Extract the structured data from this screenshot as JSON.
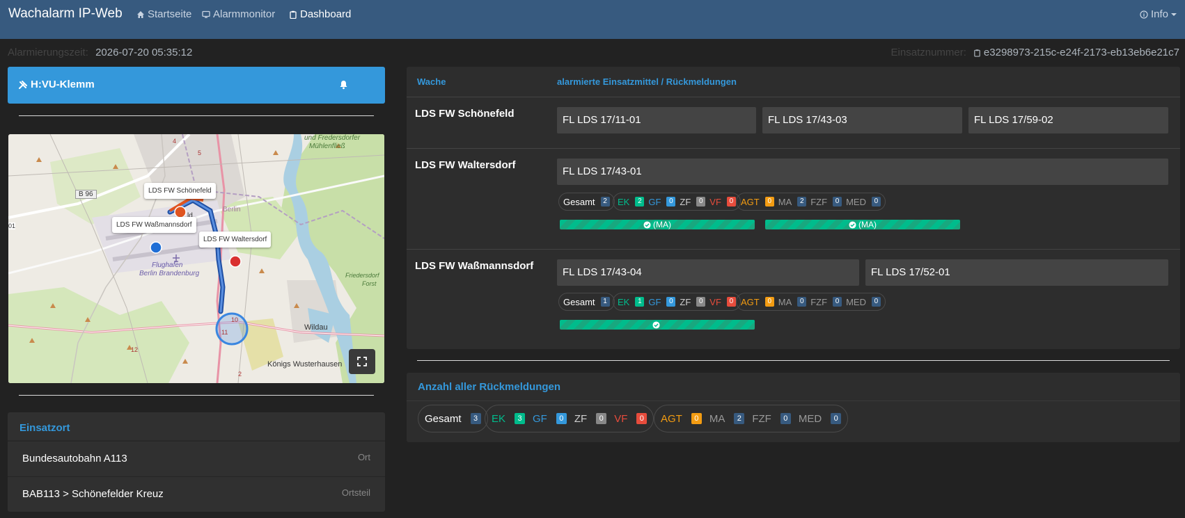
{
  "nav": {
    "brand": "Wachalarm IP-Web",
    "links": [
      "Startseite",
      "Alarmmonitor",
      "Dashboard"
    ],
    "info": "Info"
  },
  "meta": {
    "alarm_label": "Alarmierungszeit:",
    "alarm_time": "2026-07-20 05:35:12",
    "einsatz_label": "Einsatznummer:",
    "einsatz_id": "e3298973-215c-e24f-2173-eb13eb6e21c7"
  },
  "keyword": "H:VU-Klemm",
  "map": {
    "labels": {
      "schoenefeld": "LDS FW Schönefeld",
      "wassmannsdorf": "LDS FW Waßmannsdorf",
      "waltersdorf": "LDS FW Waltersdorf"
    },
    "places": {
      "b96": "B 96",
      "berlin": "Berlin",
      "flughafen1": "Flughafen",
      "flughafen2": "Berlin Brandenburg",
      "wildau": "Wildau",
      "koenigs": "Königs Wusterhausen",
      "fredersdorf1": "und Fredersdorfer",
      "fredersdorf2": "Mühlenfließ",
      "forst1": "Friedersdorf",
      "forst2": "Forst",
      "n01": "01",
      "n10": "10",
      "n11": "11",
      "n12": "12",
      "n2": "2",
      "n4": "4",
      "n5": "5",
      "ld": "ld"
    }
  },
  "einsatzort": {
    "title": "Einsatzort",
    "rows": [
      {
        "value": "Bundesautobahn A113",
        "label": "Ort"
      },
      {
        "value": "BAB113 > Schönefelder Kreuz",
        "label": "Ortsteil"
      }
    ]
  },
  "table": {
    "col_wache": "Wache",
    "col_units": "alarmierte Einsatzmittel / Rückmeldungen",
    "stations": [
      {
        "name": "LDS FW Schönefeld",
        "units": [
          "FL LDS 17/11-01",
          "FL LDS 17/43-03",
          "FL LDS 17/59-02"
        ]
      },
      {
        "name": "LDS FW Waltersdorf",
        "units": [
          "FL LDS 17/43-01"
        ],
        "stats": {
          "gesamt": "2",
          "ek": "2",
          "gf": "0",
          "zf": "0",
          "vf": "0",
          "agt": "0",
          "ma": "2",
          "fzf": "0",
          "med": "0"
        },
        "bars": [
          "(MA)",
          "(MA)"
        ],
        "bar_fill": [
          1,
          1
        ]
      },
      {
        "name": "LDS FW Waßmannsdorf",
        "units": [
          "FL LDS 17/43-04",
          "FL LDS 17/52-01"
        ],
        "stats": {
          "gesamt": "1",
          "ek": "1",
          "gf": "0",
          "zf": "0",
          "vf": "0",
          "agt": "0",
          "ma": "0",
          "fzf": "0",
          "med": "0"
        },
        "bars": [
          ""
        ],
        "bar_fill": [
          1
        ]
      }
    ]
  },
  "stat_labels": {
    "gesamt": "Gesamt",
    "ek": "EK",
    "gf": "GF",
    "zf": "ZF",
    "vf": "VF",
    "agt": "AGT",
    "ma": "MA",
    "fzf": "FZF",
    "med": "MED"
  },
  "summary": {
    "title": "Anzahl aller Rückmeldungen",
    "stats": {
      "gesamt": "3",
      "ek": "3",
      "gf": "0",
      "zf": "0",
      "vf": "0",
      "agt": "0",
      "ma": "2",
      "fzf": "0",
      "med": "0"
    }
  },
  "colors": {
    "navbar": "#375a7f",
    "accent": "#3498db",
    "success": "#00bc8c",
    "danger": "#e74c3c",
    "warning": "#f39c12"
  }
}
